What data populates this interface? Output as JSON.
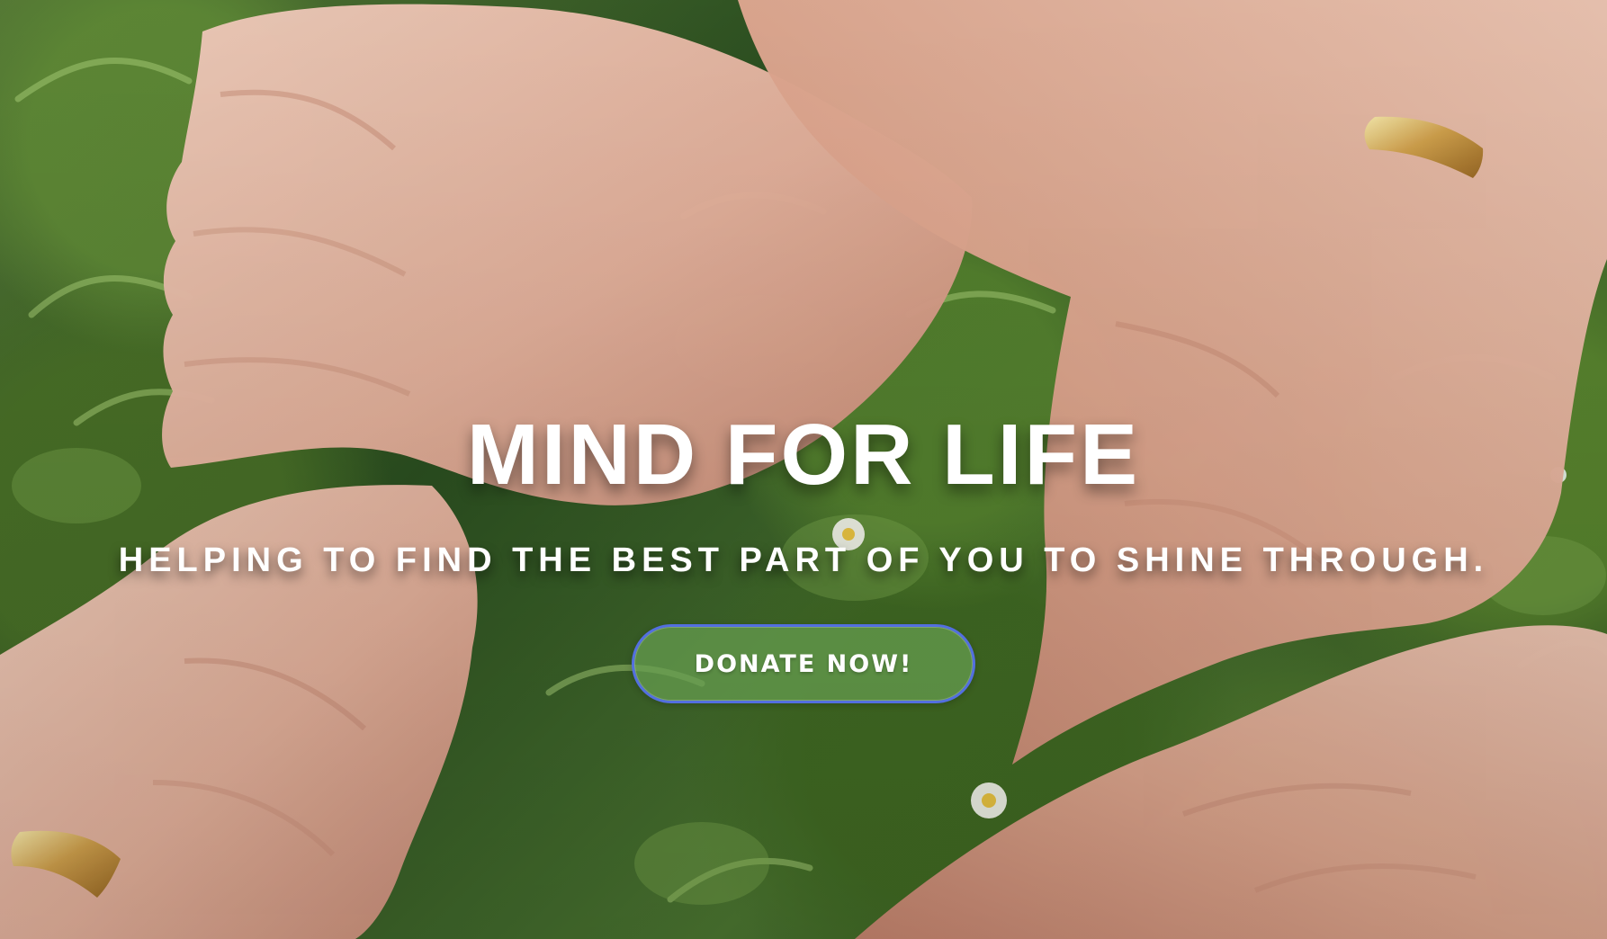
{
  "hero": {
    "background_image": "hands-joined-over-grass",
    "title": "MIND FOR LIFE",
    "tagline": "HELPING TO FIND THE BEST PART OF YOU TO SHINE THROUGH.",
    "cta_label": "DONATE NOW!"
  },
  "colors": {
    "text": "#ffffff",
    "button_border": "#536fe0",
    "button_fill": "#669e50",
    "grass_dark": "#2b4f20",
    "grass_light": "#587d37",
    "skin": "#e9b49f"
  }
}
